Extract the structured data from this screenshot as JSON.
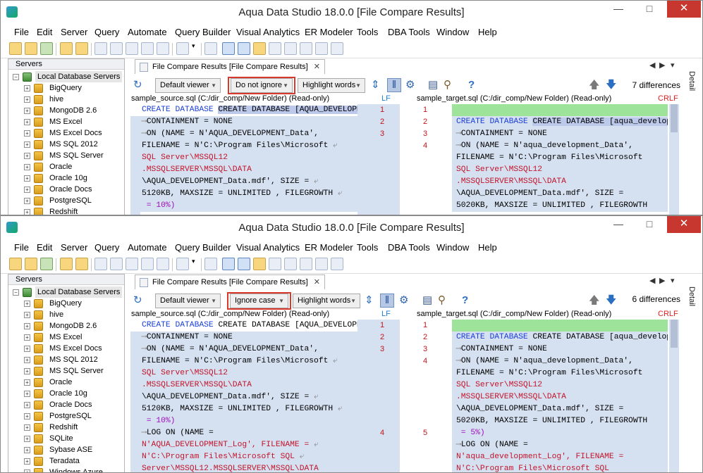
{
  "windows": [
    {
      "title": "Aqua Data Studio 18.0.0 [File Compare Results]",
      "menus": [
        "File",
        "Edit",
        "Server",
        "Query",
        "Automate",
        "Query Builder",
        "Visual Analytics",
        "ER Modeler",
        "Tools",
        "DBA Tools",
        "Window",
        "Help"
      ],
      "servers_header": "Servers",
      "root": "Local Database Servers",
      "servers": [
        "BigQuery",
        "hive",
        "MongoDB 2.6",
        "MS Excel",
        "MS Excel Docs",
        "MS SQL 2012",
        "MS SQL Server",
        "Oracle",
        "Oracle 10g",
        "Oracle Docs",
        "PostgreSQL",
        "Redshift"
      ],
      "tab": "File Compare Results [File Compare Results]",
      "viewer": "Default viewer",
      "case_option": "Do not ignore",
      "highlight": "Highlight words",
      "differences": "7 differences",
      "source_path": "sample_source.sql (C:/dir_comp/New Folder) (Read-only)",
      "target_path": "sample_target.sql (C:/dir_comp/New Folder) (Read-only)",
      "lf": "LF",
      "crlf": "CRLF",
      "detail": "Detail",
      "source_line_nums": [
        "1",
        "2",
        "3",
        "",
        "",
        "",
        "",
        "",
        ""
      ],
      "target_line_nums": [
        "1",
        "2",
        "3",
        "4",
        "",
        "",
        "",
        "",
        ""
      ]
    },
    {
      "title": "Aqua Data Studio 18.0.0 [File Compare Results]",
      "menus": [
        "File",
        "Edit",
        "Server",
        "Query",
        "Automate",
        "Query Builder",
        "Visual Analytics",
        "ER Modeler",
        "Tools",
        "DBA Tools",
        "Window",
        "Help"
      ],
      "servers_header": "Servers",
      "root": "Local Database Servers",
      "servers": [
        "BigQuery",
        "hive",
        "MongoDB 2.6",
        "MS Excel",
        "MS Excel Docs",
        "MS SQL 2012",
        "MS SQL Server",
        "Oracle",
        "Oracle 10g",
        "Oracle Docs",
        "PostgreSQL",
        "Redshift",
        "SQLite",
        "Sybase ASE",
        "Teradata",
        "Windows Azure"
      ],
      "tab": "File Compare Results [File Compare Results]",
      "viewer": "Default viewer",
      "case_option": "Ignore case",
      "highlight": "Highlight words",
      "differences": "6 differences",
      "source_path": "sample_source.sql (C:/dir_comp/New Folder) (Read-only)",
      "target_path": "sample_target.sql (C:/dir_comp/New Folder) (Read-only)",
      "lf": "LF",
      "crlf": "CRLF",
      "detail": "Detail"
    }
  ],
  "code": {
    "src": [
      "CREATE DATABASE [AQUA_DEVELOPMENT]",
      "CONTAINMENT = NONE",
      "ON (NAME = N'AQUA_DEVELOPMENT_Data',",
      "FILENAME = N'C:\\Program Files\\Microsoft",
      "SQL Server\\MSSQL12",
      ".MSSQLSERVER\\MSSQL\\DATA",
      "\\AQUA_DEVELOPMENT_Data.mdf', SIZE =",
      "5120KB, MAXSIZE = UNLIMITED , FILEGROWTH",
      " = 10%)",
      "LOG ON (NAME =",
      "N'AQUA_DEVELOPMENT_Log', FILENAME =",
      "N'C:\\Program Files\\Microsoft SQL",
      "Server\\MSSQL12.MSSQLSERVER\\MSSQL\\DATA"
    ],
    "tgt": [
      "CREATE DATABASE [aqua_development]",
      "CONTAINMENT = NONE",
      "ON (NAME = N'aqua_development_Data',",
      "FILENAME = N'C:\\Program Files\\Microsoft",
      "SQL Server\\MSSQL12",
      ".MSSQLSERVER\\MSSQL\\DATA",
      "\\AQUA_DEVELOPMENT_Data.mdf', SIZE =",
      "5020KB, MAXSIZE = UNLIMITED , FILEGROWTH",
      " = 5%)",
      "LOG ON (NAME =",
      "N'aqua_development_Log', FILENAME =",
      "N'C:\\Program Files\\Microsoft SQL"
    ],
    "w2_src_nums": [
      "1",
      "2",
      "3",
      "",
      "",
      "",
      "",
      "",
      "",
      "4",
      "",
      "",
      ""
    ],
    "w2_tgt_nums": [
      "1",
      "2",
      "3",
      "4",
      "",
      "",
      "",
      "",
      "",
      "5",
      "",
      "",
      ""
    ]
  }
}
